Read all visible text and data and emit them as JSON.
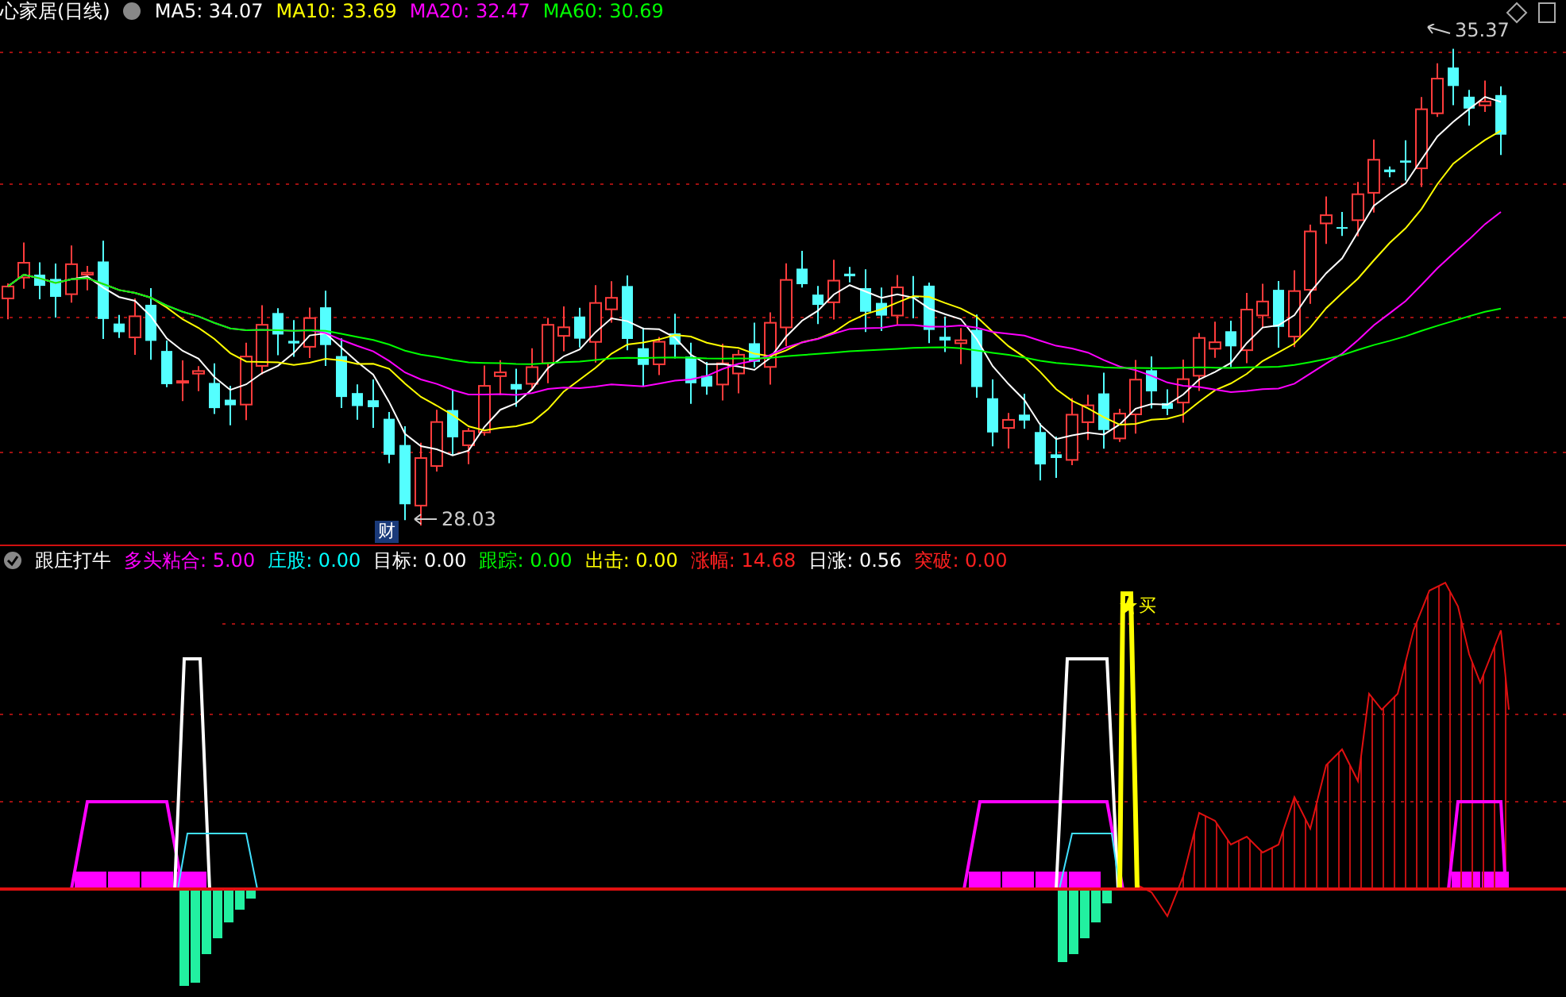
{
  "header": {
    "title": "心家居(日线)",
    "ma": [
      {
        "label": "MA5: 34.07",
        "color": "#ffffff"
      },
      {
        "label": "MA10: 33.69",
        "color": "#ffff00"
      },
      {
        "label": "MA20: 32.47",
        "color": "#ff00ff"
      },
      {
        "label": "MA60: 30.69",
        "color": "#00ff00"
      }
    ]
  },
  "price_chart": {
    "high_label": "35.37",
    "low_label": "28.03",
    "marker": "财"
  },
  "indicator": {
    "name": "跟庄打牛",
    "values": [
      {
        "label": "多头粘合: 5.00",
        "color": "#ff00ff"
      },
      {
        "label": "庄股: 0.00",
        "color": "#00ffff"
      },
      {
        "label": "目标: 0.00",
        "color": "#ffffff"
      },
      {
        "label": "跟踪: 0.00",
        "color": "#00ff00"
      },
      {
        "label": "出击: 0.00",
        "color": "#ffff00"
      },
      {
        "label": "涨幅: 14.68",
        "color": "#ff2020"
      },
      {
        "label": "日涨: 0.56",
        "color": "#ffffff"
      },
      {
        "label": "突破: 0.00",
        "color": "#ff2020"
      }
    ],
    "signal": "买"
  }
}
